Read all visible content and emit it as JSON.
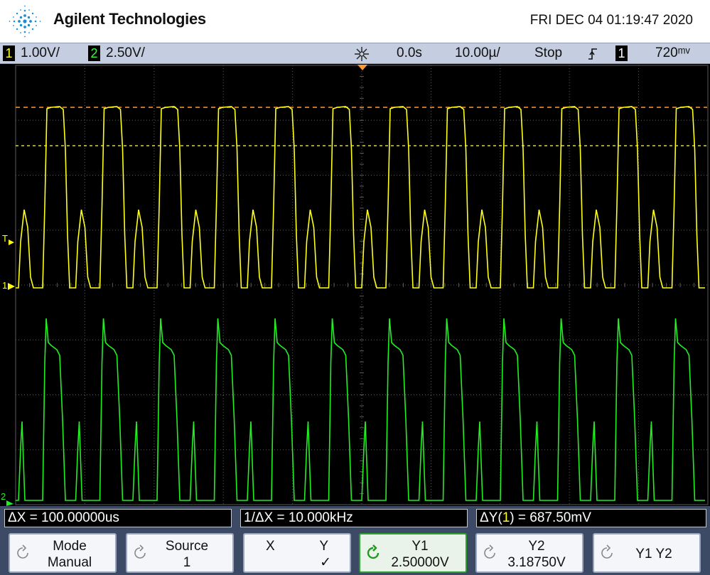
{
  "header": {
    "brand": "Agilent Technologies",
    "datetime": "FRI DEC 04 01:19:47 2020",
    "logo_icon": "agilent-spark-logo-icon"
  },
  "status_bar": {
    "ch1_number": "1",
    "ch1_scale": "1.00V/",
    "ch2_number": "2",
    "ch2_scale": "2.50V/",
    "acq_icon": "acquisition-sparkle-icon",
    "time_delay": "0.0s",
    "time_scale": "10.00µ/",
    "run_state": "Stop",
    "trigger_slope_icon": "rising-edge-trigger-icon",
    "trigger_source": "1",
    "trigger_level": "720ᵐᵛ"
  },
  "screen": {
    "trigger_marker": "T",
    "ch1_ground_marker": "1",
    "ch2_ground_marker": "2",
    "colors": {
      "ch1": "#ffff1a",
      "ch2": "#22ee22",
      "grid": "#5a5a5a",
      "cursor_y1": "#ff9933",
      "cursor_y2": "#ffff66"
    }
  },
  "readouts": {
    "delta_x": "ΔX = 100.00000us",
    "inv_delta_x": "1/ΔX = 10.000kHz",
    "delta_y_prefix": "ΔY(",
    "delta_y_channel": "1",
    "delta_y_suffix": ") = 687.50mV"
  },
  "softkeys": [
    {
      "line1": "Mode",
      "line2": "Manual",
      "icon": "knob-icon"
    },
    {
      "line1": "Source",
      "line2": "1",
      "icon": "knob-icon"
    },
    {
      "line1_left": "X",
      "line1_right": "Y",
      "line2": "✓"
    },
    {
      "line1": "Y1",
      "line2": "2.50000V",
      "icon": "active-knob-icon"
    },
    {
      "line1": "Y2",
      "line2": "3.18750V",
      "icon": "knob-icon"
    },
    {
      "line1": "Y1 Y2",
      "icon": "knob-icon"
    }
  ]
}
